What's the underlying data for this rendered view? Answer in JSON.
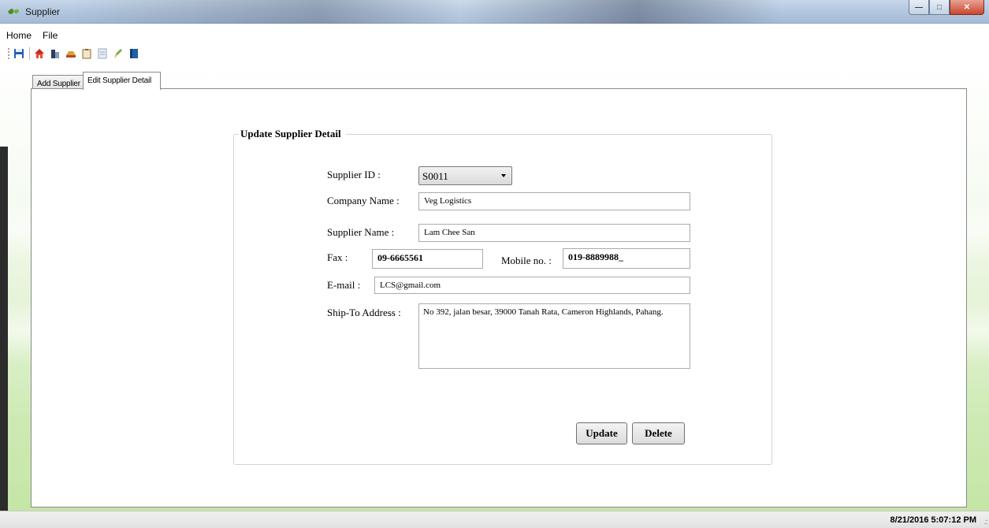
{
  "window": {
    "title": "Supplier"
  },
  "menu": {
    "items": [
      "Home",
      "File"
    ]
  },
  "toolbar": {
    "icons": [
      "save-icon",
      "home-icon",
      "supplier-icon",
      "truck-icon",
      "clipboard-icon",
      "report-icon",
      "clean-icon",
      "book-icon"
    ]
  },
  "tabs": [
    {
      "label": "Add Supplier",
      "active": false
    },
    {
      "label": "Edit Supplier Detail",
      "active": true
    }
  ],
  "form": {
    "group_title": "Update Supplier Detail",
    "supplier_id": {
      "label": "Supplier ID :",
      "value": "S0011"
    },
    "company_name": {
      "label": "Company Name :",
      "value": "Veg Logistics"
    },
    "supplier_name": {
      "label": "Supplier Name :",
      "value": "Lam Chee San"
    },
    "fax": {
      "label": "Fax :",
      "value": "09-6665561"
    },
    "mobile": {
      "label": "Mobile no. :",
      "value": "019-8889988_"
    },
    "email": {
      "label": "E-mail :",
      "value": "LCS@gmail.com"
    },
    "ship_to": {
      "label": "Ship-To Address :",
      "value": "No 392, jalan besar, 39000 Tanah Rata, Cameron Highlands, Pahang."
    },
    "update_button": "Update",
    "delete_button": "Delete"
  },
  "status": {
    "datetime": "8/21/2016 5:07:12 PM",
    "grip": ".::"
  },
  "colors": {
    "accent_green": "#c5e6a7",
    "close_red": "#c9462f",
    "titlebar": "#b4c8df"
  }
}
